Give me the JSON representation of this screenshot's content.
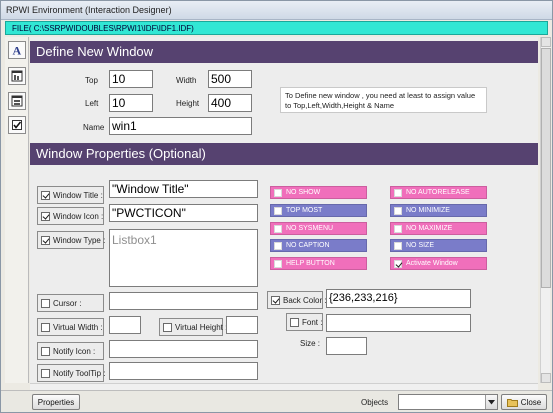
{
  "window": {
    "title": "RPWI Environment (Interaction Designer)"
  },
  "file_bar": {
    "text": "FILE( C:\\SSRPWIDOUBLES\\RPWI1\\IDF\\IDF1.IDF)"
  },
  "toolstrip": {
    "tools": [
      "text-tool-icon",
      "window-tool-icon",
      "form-tool-icon",
      "checkbox-tool-icon"
    ]
  },
  "define": {
    "header": "Define New Window",
    "top_label": "Top",
    "top_value": "10",
    "left_label": "Left",
    "left_value": "10",
    "width_label": "Width",
    "width_value": "500",
    "height_label": "Height",
    "height_value": "400",
    "name_label": "Name",
    "name_value": "win1",
    "info": "To Define new window , you need at least to assign value to Top,Left,Width,Height & Name"
  },
  "props": {
    "header": "Window Properties (Optional)",
    "window_title_label": "Window Title :",
    "window_title_value": "\"Window Title\"",
    "window_title_checked": true,
    "window_icon_label": "Window Icon :",
    "window_icon_value": "\"PWCTICON\"",
    "window_icon_checked": true,
    "window_type_label": "Window Type :",
    "window_type_value": "Listbox1",
    "window_type_checked": true,
    "cursor_label": "Cursor :",
    "cursor_checked": false,
    "virtual_width_label": "Virtual Width :",
    "virtual_width_checked": false,
    "virtual_height_label": "Virtual Height :",
    "virtual_height_checked": false,
    "notify_icon_label": "Notify Icon :",
    "notify_icon_checked": false,
    "notify_tooltip_label": "Notify ToolTip :",
    "notify_tooltip_checked": false,
    "back_color_label": "Back Color :",
    "back_color_value": "{236,233,216}",
    "back_color_checked": true,
    "font_label": "Font :",
    "font_checked": false,
    "size_label": "Size :",
    "options_left": [
      {
        "label": "NO SHOW",
        "checked": false,
        "color": "pink"
      },
      {
        "label": "TOP MOST",
        "checked": false,
        "color": "blue"
      },
      {
        "label": "NO SYSMENU",
        "checked": false,
        "color": "pink"
      },
      {
        "label": "NO CAPTION",
        "checked": false,
        "color": "blue"
      },
      {
        "label": "HELP BUTTON",
        "checked": false,
        "color": "pink"
      }
    ],
    "options_right": [
      {
        "label": "NO AUTORELEASE",
        "checked": false,
        "color": "pink"
      },
      {
        "label": "NO MINIMIZE",
        "checked": false,
        "color": "blue"
      },
      {
        "label": "NO MAXIMIZE",
        "checked": false,
        "color": "pink"
      },
      {
        "label": "NO SIZE",
        "checked": false,
        "color": "blue"
      },
      {
        "label": "Activate Window",
        "checked": true,
        "color": "pink"
      }
    ]
  },
  "statusbar": {
    "properties_label": "Properties",
    "objects_label": "Objects",
    "close_label": "Close"
  },
  "colors": {
    "header": "#564270",
    "filebar": "#31e7d4",
    "pink": "#f06fbb",
    "blue": "#7a7cc9"
  }
}
